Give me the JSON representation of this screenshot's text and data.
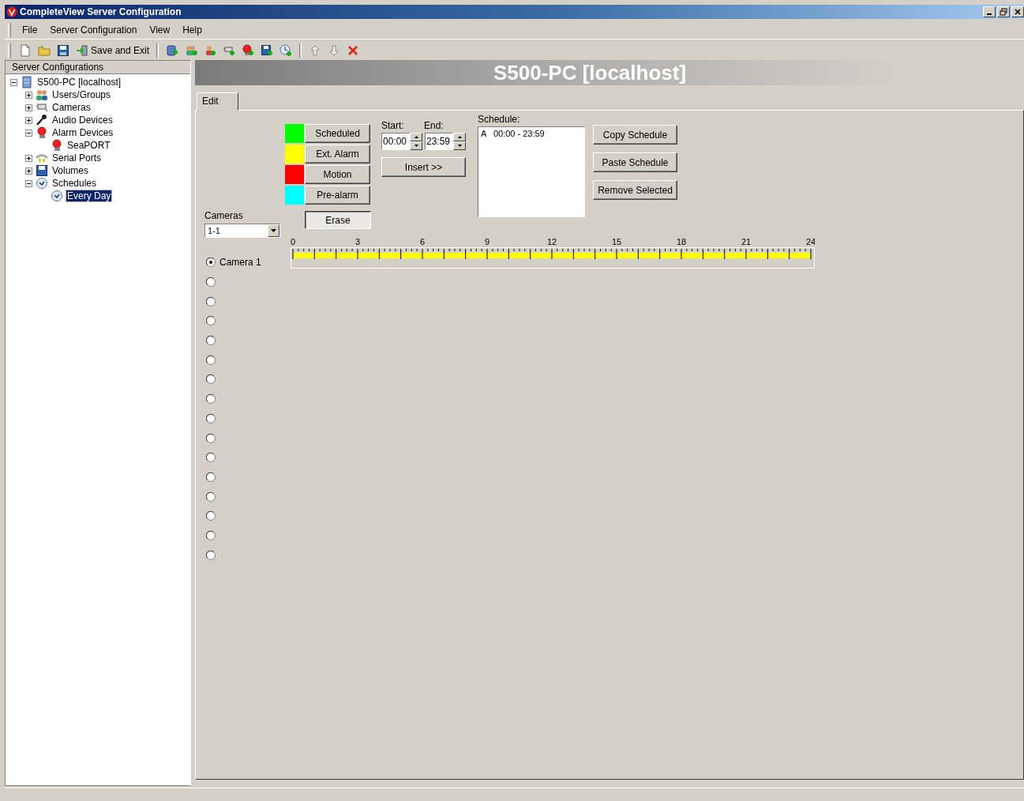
{
  "window": {
    "title": "CompleteView Server Configuration"
  },
  "menu": [
    "File",
    "Server Configuration",
    "View",
    "Help"
  ],
  "toolbar": {
    "save_exit_label": "Save and Exit"
  },
  "sidebar": {
    "title": "Server Configurations",
    "tree": [
      {
        "label": "S500-PC [localhost]",
        "expanded": true,
        "selected": false,
        "children": [
          {
            "label": "Users/Groups",
            "expanded": false,
            "selected": false
          },
          {
            "label": "Cameras",
            "expanded": false,
            "selected": false
          },
          {
            "label": "Audio Devices",
            "expanded": false,
            "selected": false
          },
          {
            "label": "Alarm Devices",
            "expanded": true,
            "selected": false,
            "children": [
              {
                "label": "SeaPORT",
                "selected": false
              }
            ]
          },
          {
            "label": "Serial Ports",
            "expanded": false,
            "selected": false
          },
          {
            "label": "Volumes",
            "expanded": false,
            "selected": false
          },
          {
            "label": "Schedules",
            "expanded": true,
            "selected": false,
            "children": [
              {
                "label": "Every Day",
                "selected": true
              }
            ]
          }
        ]
      }
    ]
  },
  "header": {
    "title": "S500-PC [localhost]"
  },
  "tabs": [
    {
      "label": "Edit",
      "selected": true
    }
  ],
  "brushes": [
    {
      "kind": "color",
      "label": "Scheduled",
      "color": "#00ff00",
      "selected": false
    },
    {
      "kind": "color",
      "label": "Ext. Alarm",
      "color": "#ffff00",
      "selected": false
    },
    {
      "kind": "color",
      "label": "Motion",
      "color": "#ff0000",
      "selected": false
    },
    {
      "kind": "color",
      "label": "Pre-alarm",
      "color": "#00ffff",
      "selected": false
    },
    {
      "kind": "erase",
      "label": "Erase",
      "selected": true
    }
  ],
  "time": {
    "start_label": "Start:",
    "start_value": "00:00",
    "end_label": "End:",
    "end_value": "23:59",
    "insert_button": "Insert >>"
  },
  "schedule": {
    "label": "Schedule:",
    "items": [
      {
        "text": "A   00:00 - 23:59",
        "selected": false
      }
    ]
  },
  "schedule_buttons": [
    "Copy Schedule",
    "Paste Schedule",
    "Remove Selected"
  ],
  "cameras": {
    "label": "Cameras",
    "value": "1-1",
    "items": [
      {
        "label": "Camera 1",
        "selected": true
      },
      {
        "selected": false
      },
      {
        "selected": false
      },
      {
        "selected": false
      },
      {
        "selected": false
      },
      {
        "selected": false
      },
      {
        "selected": false
      },
      {
        "selected": false
      },
      {
        "selected": false
      },
      {
        "selected": false
      },
      {
        "selected": false
      },
      {
        "selected": false
      },
      {
        "selected": false
      },
      {
        "selected": false
      },
      {
        "selected": false
      },
      {
        "selected": false
      }
    ]
  },
  "timeline": {
    "hour_labels": [
      "0",
      "3",
      "6",
      "9",
      "12",
      "15",
      "18",
      "21",
      "24"
    ],
    "level": 1
  }
}
